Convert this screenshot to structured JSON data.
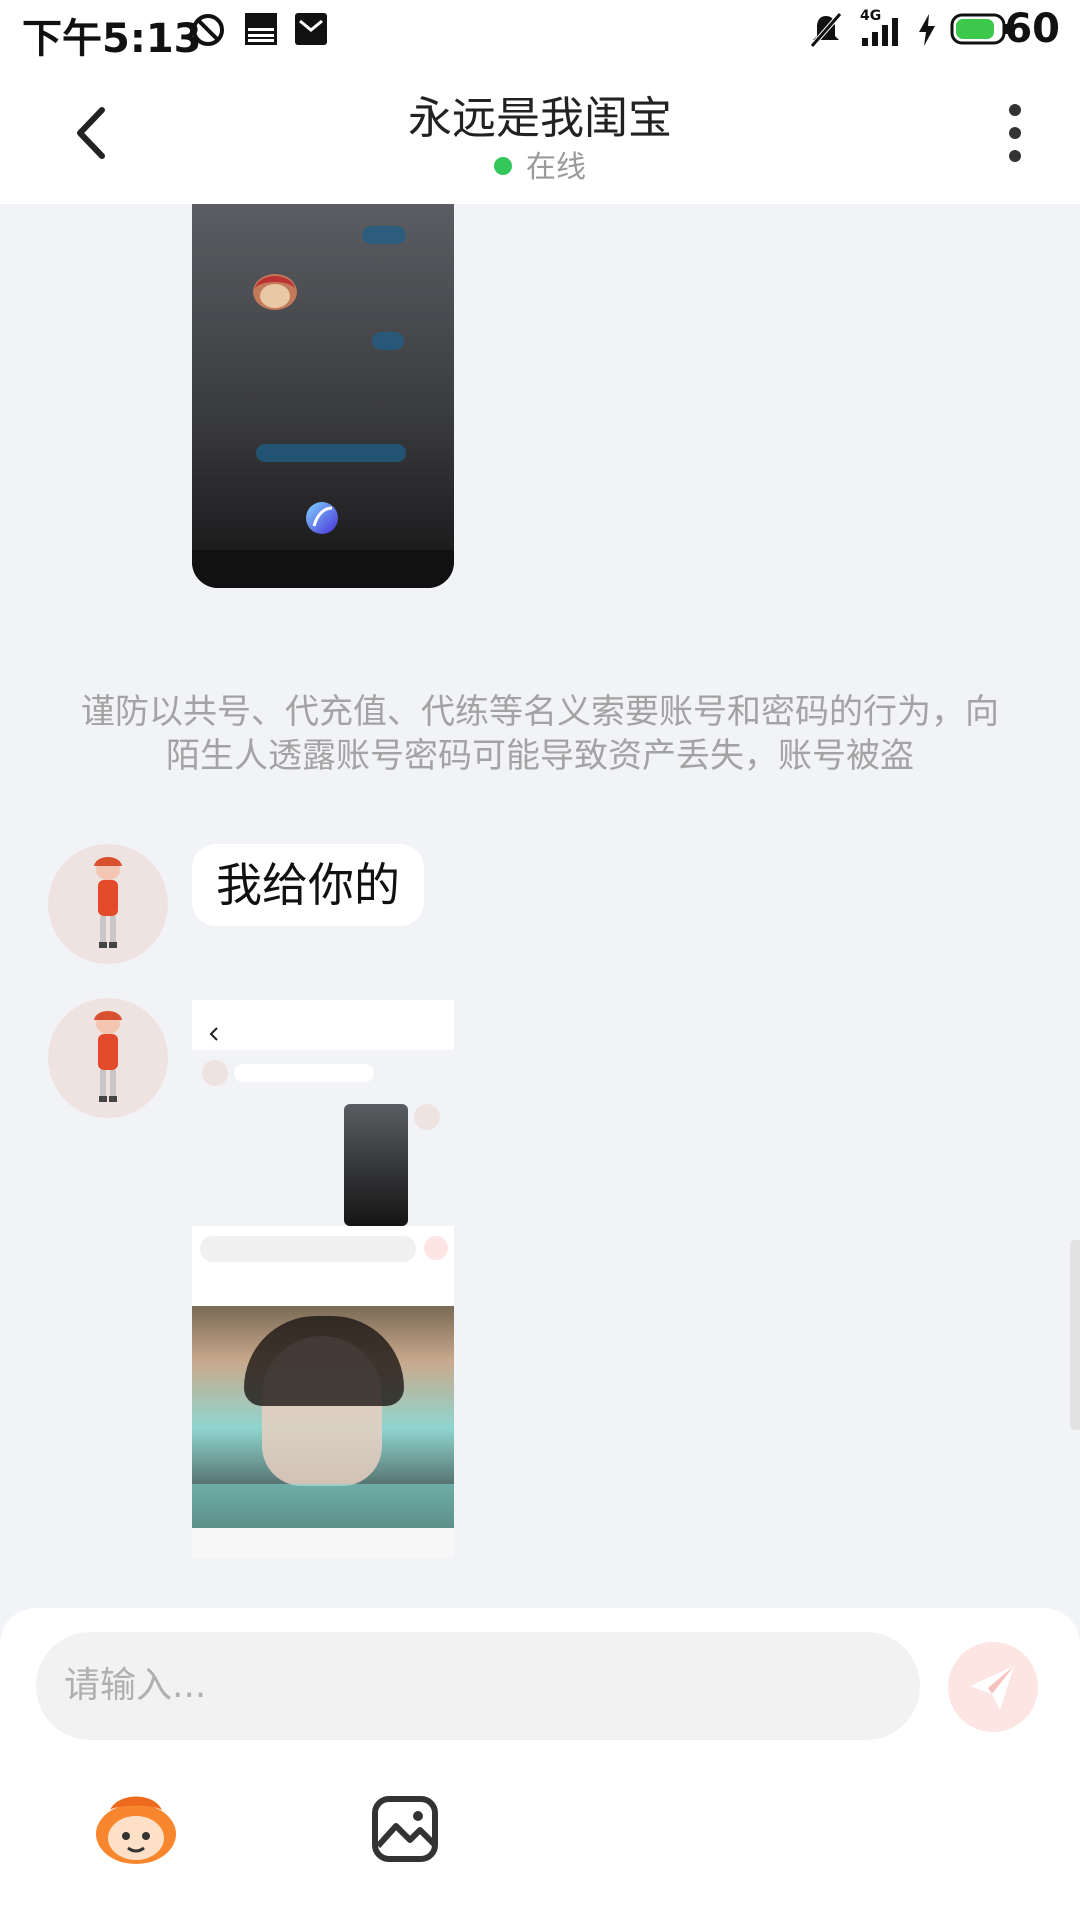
{
  "status_bar": {
    "time": "下午5:13",
    "network": "4G",
    "battery": "60"
  },
  "header": {
    "title": "永远是我闺宝",
    "status": "在线"
  },
  "messages": {
    "warning": "谨防以共号、代充值、代练等名义索要账号和密码的行为，向陌生人透露账号密码可能导致资产丢失，账号被盗",
    "text_1": "我给你的"
  },
  "input": {
    "placeholder": "请输入..."
  },
  "colors": {
    "online": "#33c65a",
    "send_button": "#fde5e3",
    "background": "#f2f3f7"
  },
  "icons": [
    "back-icon",
    "more-icon",
    "send-icon",
    "emoji-icon",
    "image-icon"
  ]
}
